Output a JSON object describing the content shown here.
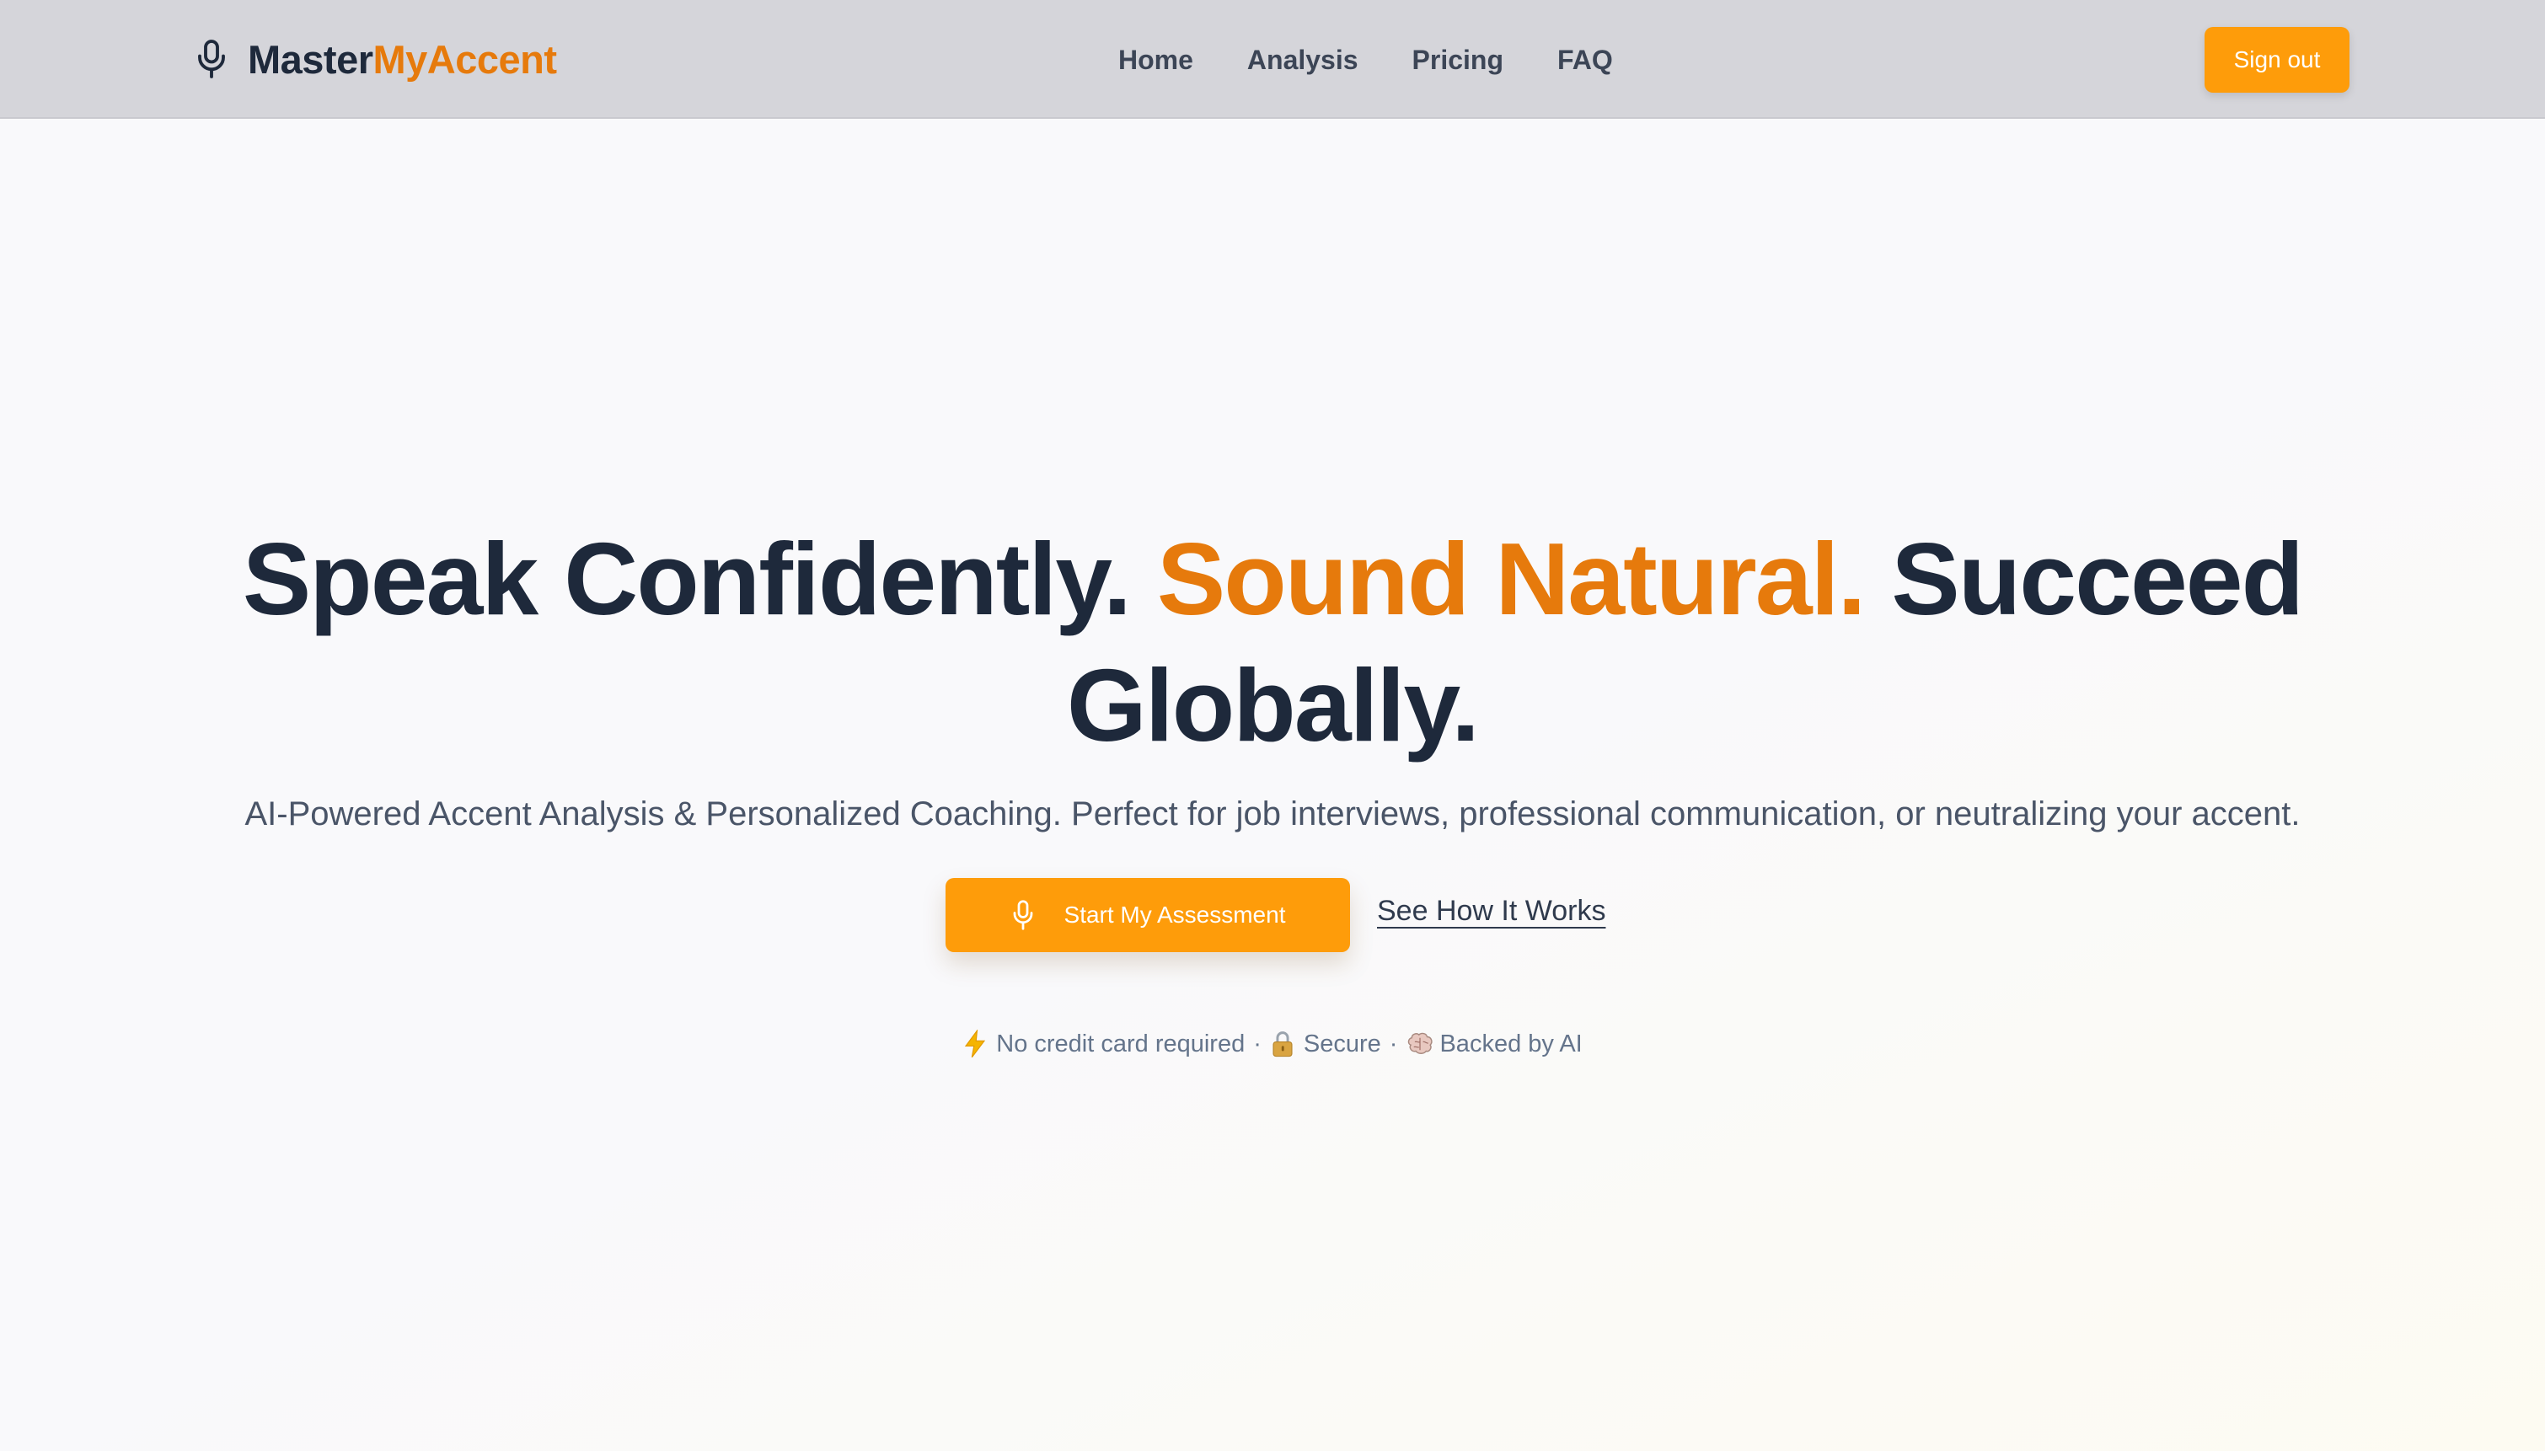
{
  "brand": {
    "name_part_a": "Master",
    "name_part_b": "MyAccent",
    "icon": "microphone-icon",
    "colors": {
      "dark": "#1e293b",
      "accent": "#e67a0c",
      "button": "#fe9c0a"
    }
  },
  "nav": {
    "items": [
      {
        "label": "Home"
      },
      {
        "label": "Analysis"
      },
      {
        "label": "Pricing"
      },
      {
        "label": "FAQ"
      }
    ]
  },
  "header": {
    "signout_label": "Sign out"
  },
  "hero": {
    "title_part1": "Speak Confidently.",
    "title_part2": "Sound Natural.",
    "title_part3": "Succeed Globally.",
    "subtitle": "AI-Powered Accent Analysis & Personalized Coaching. Perfect for job interviews, professional communication, or neutralizing your accent.",
    "primary_cta": "Start My Assessment",
    "secondary_cta": "See How It Works"
  },
  "trust": {
    "items": [
      {
        "icon": "lightning-icon",
        "label": "No credit card required"
      },
      {
        "icon": "lock-icon",
        "label": "Secure"
      },
      {
        "icon": "brain-icon",
        "label": "Backed by AI"
      }
    ],
    "separator": "·"
  }
}
